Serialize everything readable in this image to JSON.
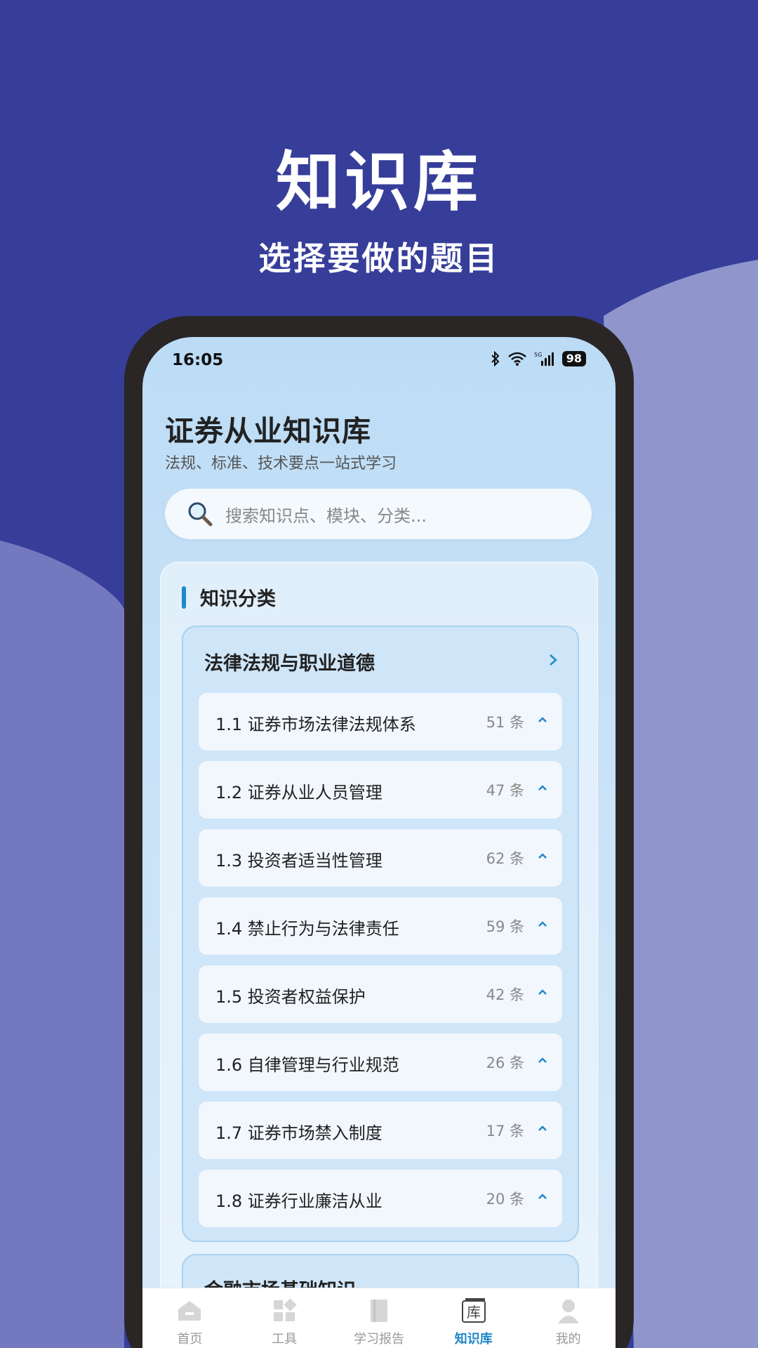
{
  "promo": {
    "title": "知识库",
    "subtitle": "选择要做的题目"
  },
  "status_bar": {
    "time": "16:05",
    "battery": "98",
    "network": "5G"
  },
  "header": {
    "title": "证券从业知识库",
    "subtitle": "法规、标准、技术要点一站式学习"
  },
  "search": {
    "placeholder": "搜索知识点、模块、分类..."
  },
  "section": {
    "title": "知识分类"
  },
  "groups": [
    {
      "title": "法律法规与职业道德",
      "items": [
        {
          "label": "1.1 证券市场法律法规体系",
          "count": "51 条"
        },
        {
          "label": "1.2 证券从业人员管理",
          "count": "47 条"
        },
        {
          "label": "1.3 投资者适当性管理",
          "count": "62 条"
        },
        {
          "label": "1.4 禁止行为与法律责任",
          "count": "59 条"
        },
        {
          "label": "1.5 投资者权益保护",
          "count": "42 条"
        },
        {
          "label": "1.6 自律管理与行业规范",
          "count": "26 条"
        },
        {
          "label": "1.7 证券市场禁入制度",
          "count": "17 条"
        },
        {
          "label": "1.8 证券行业廉洁从业",
          "count": "20 条"
        }
      ]
    },
    {
      "title": "金融市场基础知识"
    }
  ],
  "tabbar": {
    "tabs": [
      {
        "label": "首页",
        "icon": "home-icon"
      },
      {
        "label": "工具",
        "icon": "grid-icon"
      },
      {
        "label": "学习报告",
        "icon": "book-icon"
      },
      {
        "label": "知识库",
        "icon": "library-icon",
        "active": true
      },
      {
        "label": "我的",
        "icon": "user-icon"
      }
    ]
  },
  "colors": {
    "background": "#363e9a",
    "accent": "#1e88c8",
    "phone_frame": "#2a2626"
  }
}
